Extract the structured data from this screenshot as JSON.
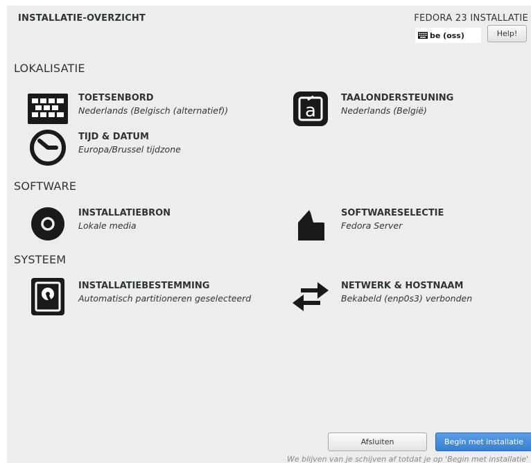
{
  "header": {
    "title": "INSTALLATIE-OVERZICHT",
    "product": "FEDORA 23 INSTALLATIE",
    "keyboard_layout": "be (oss)",
    "help_label": "Help!"
  },
  "sections": {
    "localization": "LOKALISATIE",
    "software": "SOFTWARE",
    "system": "SYSTEEM"
  },
  "spokes": {
    "keyboard": {
      "title": "TOETSENBORD",
      "status": "Nederlands (Belgisch (alternatief))",
      "icon": "keyboard-icon"
    },
    "language": {
      "title": "TAALONDERSTEUNING",
      "status": "Nederlands (België)",
      "icon": "language-icon"
    },
    "datetime": {
      "title": "TIJD & DATUM",
      "status": "Europa/Brussel tijdzone",
      "icon": "clock-icon"
    },
    "source": {
      "title": "INSTALLATIEBRON",
      "status": "Lokale media",
      "icon": "disc-icon"
    },
    "software_selection": {
      "title": "SOFTWARESELECTIE",
      "status": "Fedora Server",
      "icon": "package-icon"
    },
    "destination": {
      "title": "INSTALLATIEBESTEMMING",
      "status": "Automatisch partitioneren geselecteerd",
      "icon": "harddisk-icon"
    },
    "network": {
      "title": "NETWERK & HOSTNAAM",
      "status": "Bekabeld (enp0s3) verbonden",
      "icon": "network-arrows-icon"
    }
  },
  "footer": {
    "quit_label": "Afsluiten",
    "begin_label": "Begin met installatie",
    "warning": "We blijven van je schijven af totdat je op 'Begin met installatie' klikt."
  },
  "colors": {
    "background": "#ededed",
    "primary_button": "#3a7fd0",
    "text": "#2e3436"
  }
}
